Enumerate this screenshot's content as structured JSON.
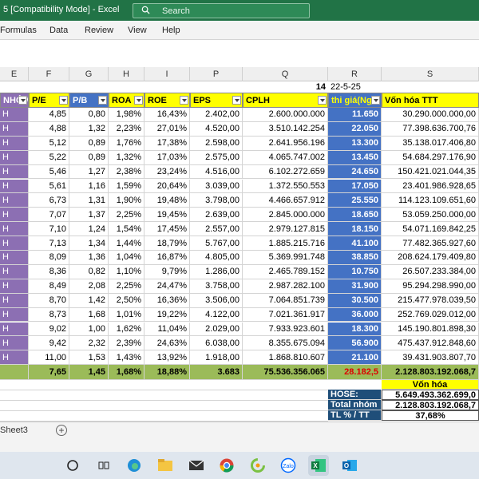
{
  "titlebar": {
    "title": "5  [Compatibility Mode]  -  Excel",
    "search_placeholder": "Search"
  },
  "menu": [
    "Formulas",
    "Data",
    "Review",
    "View",
    "Help"
  ],
  "columns": [
    "E",
    "F",
    "G",
    "H",
    "I",
    "P",
    "Q",
    "R",
    "S"
  ],
  "info_row": {
    "number": "14",
    "date": "22-5-25"
  },
  "headers": [
    "NHÓM",
    "P/E",
    "P/B",
    "ROA",
    "ROE",
    "EPS",
    "CPLH",
    "thi giá(Ng",
    "Vốn hóa TTT"
  ],
  "rows": [
    [
      "H",
      "4,85",
      "0,80",
      "1,98%",
      "16,43%",
      "2.402,00",
      "2.600.000.000",
      "11.650",
      "30.290.000.000,00"
    ],
    [
      "H",
      "4,88",
      "1,32",
      "2,23%",
      "27,01%",
      "4.520,00",
      "3.510.142.254",
      "22.050",
      "77.398.636.700,76"
    ],
    [
      "H",
      "5,12",
      "0,89",
      "1,76%",
      "17,38%",
      "2.598,00",
      "2.641.956.196",
      "13.300",
      "35.138.017.406,80"
    ],
    [
      "H",
      "5,22",
      "0,89",
      "1,32%",
      "17,03%",
      "2.575,00",
      "4.065.747.002",
      "13.450",
      "54.684.297.176,90"
    ],
    [
      "H",
      "5,46",
      "1,27",
      "2,38%",
      "23,24%",
      "4.516,00",
      "6.102.272.659",
      "24.650",
      "150.421.021.044,35"
    ],
    [
      "H",
      "5,61",
      "1,16",
      "1,59%",
      "20,64%",
      "3.039,00",
      "1.372.550.553",
      "17.050",
      "23.401.986.928,65"
    ],
    [
      "H",
      "6,73",
      "1,31",
      "1,90%",
      "19,48%",
      "3.798,00",
      "4.466.657.912",
      "25.550",
      "114.123.109.651,60"
    ],
    [
      "H",
      "7,07",
      "1,37",
      "2,25%",
      "19,45%",
      "2.639,00",
      "2.845.000.000",
      "18.650",
      "53.059.250.000,00"
    ],
    [
      "H",
      "7,10",
      "1,24",
      "1,54%",
      "17,45%",
      "2.557,00",
      "2.979.127.815",
      "18.150",
      "54.071.169.842,25"
    ],
    [
      "H",
      "7,13",
      "1,34",
      "1,44%",
      "18,79%",
      "5.767,00",
      "1.885.215.716",
      "41.100",
      "77.482.365.927,60"
    ],
    [
      "H",
      "8,09",
      "1,36",
      "1,04%",
      "16,87%",
      "4.805,00",
      "5.369.991.748",
      "38.850",
      "208.624.179.409,80"
    ],
    [
      "H",
      "8,36",
      "0,82",
      "1,10%",
      "9,79%",
      "1.286,00",
      "2.465.789.152",
      "10.750",
      "26.507.233.384,00"
    ],
    [
      "H",
      "8,49",
      "2,08",
      "2,25%",
      "24,47%",
      "3.758,00",
      "2.987.282.100",
      "31.900",
      "95.294.298.990,00"
    ],
    [
      "H",
      "8,70",
      "1,42",
      "2,50%",
      "16,36%",
      "3.506,00",
      "7.064.851.739",
      "30.500",
      "215.477.978.039,50"
    ],
    [
      "H",
      "8,73",
      "1,68",
      "1,01%",
      "19,22%",
      "4.122,00",
      "7.021.361.917",
      "36.000",
      "252.769.029.012,00"
    ],
    [
      "H",
      "9,02",
      "1,00",
      "1,62%",
      "11,04%",
      "2.029,00",
      "7.933.923.601",
      "18.300",
      "145.190.801.898,30"
    ],
    [
      "H",
      "9,42",
      "2,32",
      "2,39%",
      "24,63%",
      "6.038,00",
      "8.355.675.094",
      "56.900",
      "475.437.912.848,60"
    ],
    [
      "H",
      "11,00",
      "1,53",
      "1,43%",
      "13,92%",
      "1.918,00",
      "1.868.810.607",
      "21.100",
      "39.431.903.807,70"
    ]
  ],
  "totals": [
    "",
    "7,65",
    "1,45",
    "1,68%",
    "18,88%",
    "3.683",
    "75.536.356.065",
    "28.182,5",
    "2.128.803.192.068,7"
  ],
  "summary": {
    "head": "Vốn hóa",
    "items": [
      {
        "label": "HOSE:",
        "value": "5.649.493.362.699,0"
      },
      {
        "label": "Total nhóm",
        "value": "2.128.803.192.068,7"
      },
      {
        "label": "TL % / TT",
        "value": "37,68%"
      }
    ]
  },
  "sheet_tab": "Sheet3",
  "add_sheet": "+",
  "colors": {
    "excel_green": "#217346",
    "header_yellow": "#ffff00",
    "group_purple": "#8c6fb3",
    "price_blue": "#4472c4",
    "total_green": "#9bbb59"
  },
  "taskbar_icons": [
    "start-icon",
    "task-view-icon",
    "edge-icon",
    "file-explorer-icon",
    "mail-icon",
    "chrome-icon",
    "app-green-icon",
    "zalo-icon",
    "excel-icon",
    "outlook-icon"
  ]
}
